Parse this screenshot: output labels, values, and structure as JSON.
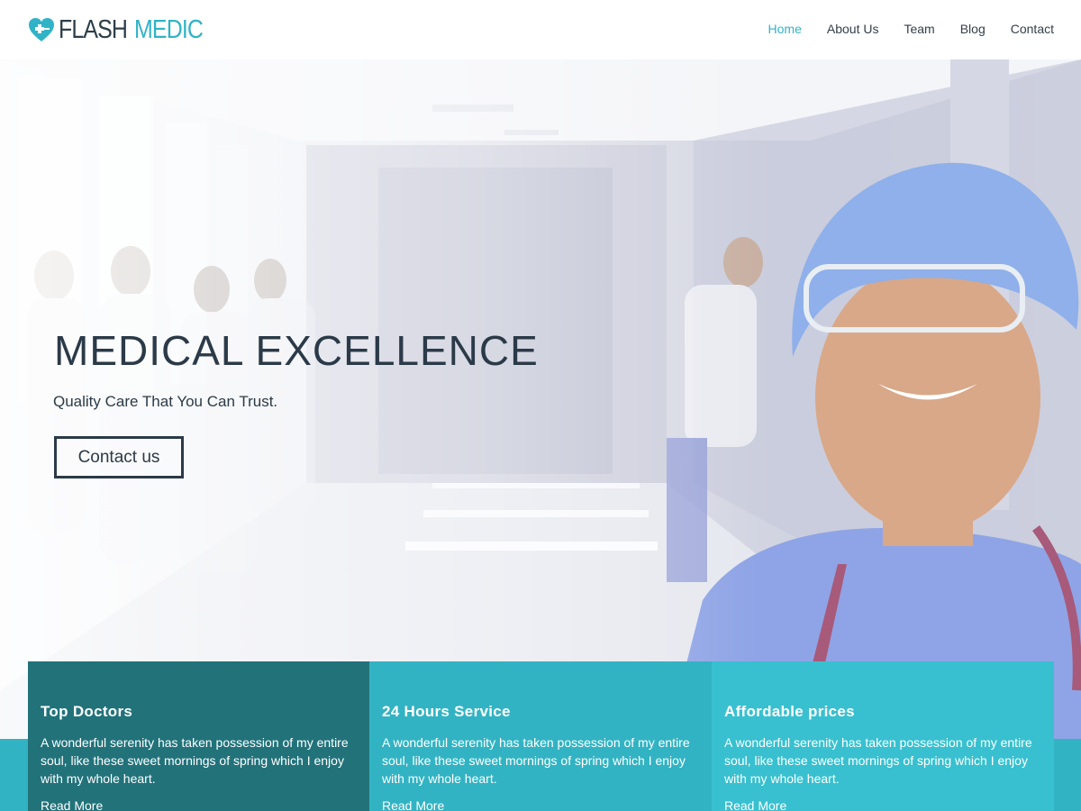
{
  "brand": {
    "name_part1": "FLASH",
    "name_part2": "MEDIC",
    "icon": "heart-cross-icon",
    "accent_color": "#30b3c6",
    "dark_color": "#2c3e4a"
  },
  "nav": {
    "items": [
      {
        "label": "Home",
        "active": true
      },
      {
        "label": "About Us",
        "active": false
      },
      {
        "label": "Team",
        "active": false
      },
      {
        "label": "Blog",
        "active": false
      },
      {
        "label": "Contact",
        "active": false
      }
    ]
  },
  "hero": {
    "title": "MEDICAL EXCELLENCE",
    "subtitle": "Quality Care That You Can Trust.",
    "button_label": "Contact us"
  },
  "features": [
    {
      "title": "Top Doctors",
      "text": "A wonderful serenity has taken possession of my entire soul, like these sweet mornings of spring which I enjoy with my whole heart.",
      "link": "Read More",
      "color": "#22727a"
    },
    {
      "title": "24 Hours Service",
      "text": "A wonderful serenity has taken possession of my entire soul, like these sweet mornings of spring which I enjoy with my whole heart.",
      "link": "Read More",
      "color": "#32b3c3"
    },
    {
      "title": "Affordable prices",
      "text": "A wonderful serenity has taken possession of my entire soul, like these sweet mornings of spring which I enjoy with my whole heart.",
      "link": "Read More",
      "color": "#38c0d0"
    }
  ]
}
